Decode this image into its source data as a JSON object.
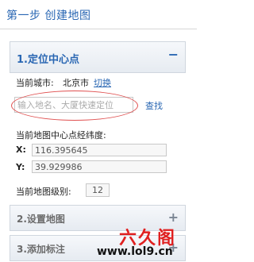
{
  "header": {
    "title": "第一步 创建地图"
  },
  "panels": [
    {
      "title": "1.定位中心点",
      "toggle": "−"
    },
    {
      "title": "2.设置地图",
      "toggle": "+"
    },
    {
      "title": "3.添加标注",
      "toggle": "+"
    }
  ],
  "locate": {
    "city_label": "当前城市:",
    "city_value": "北京市",
    "switch_label": "切换",
    "search_placeholder": "输入地名、大厦快速定位",
    "search_button": "查找",
    "coord_label": "当前地图中心点经纬度:",
    "x_label": "X:",
    "x_value": "116.395645",
    "y_label": "Y:",
    "y_value": "39.929986",
    "zoom_label": "当前地图级别:",
    "zoom_value": "12"
  },
  "watermark": {
    "logo": "六久阁",
    "url": "www.lol9.cn"
  },
  "colors": {
    "accent": "#2a67b3",
    "highlight_ring": "#e05050",
    "watermark": "#e02020"
  }
}
